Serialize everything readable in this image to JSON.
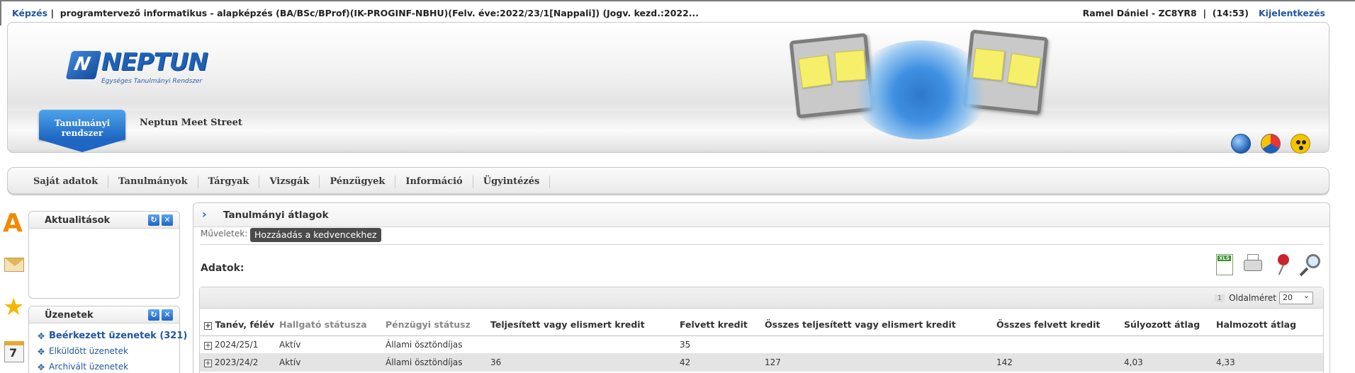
{
  "topbar": {
    "training_link": "Képzés",
    "training_text": "programtervező informatikus - alapképzés (BA/BSc/BProf)(IK-PROGINF-NBHU)(Felv. éve:2022/23/1[Nappali]) (Jogv. kezd.:2022...",
    "user": "Ramel Dániel - ZC8YR8",
    "session_time": "(14:53)",
    "logout": "Kijelentkezés"
  },
  "header": {
    "logo_text": "NEPTUN",
    "logo_sub": "Egységes Tanulmányi Rendszer",
    "tab_active": "Tanulmányi rendszer",
    "tab_other": "Neptun Meet Street"
  },
  "mainnav": {
    "items": [
      "Saját adatok",
      "Tanulmányok",
      "Tárgyak",
      "Vizsgák",
      "Pénzügyek",
      "Információ",
      "Ügyintézés"
    ]
  },
  "portlets": {
    "news": {
      "title": "Aktualitások"
    },
    "messages": {
      "title": "Üzenetek",
      "items": [
        "Beérkezett üzenetek (321)",
        "Elküldött üzenetek",
        "Archivált üzenetek"
      ]
    }
  },
  "content": {
    "title": "Tanulmányi átlagok",
    "ops_label": "Műveletek:",
    "ops_button": "Hozzáadás a kedvencekhez",
    "data_label": "Adatok:",
    "pager": {
      "page": "1",
      "label": "Oldalméret",
      "size": "20"
    },
    "columns": [
      "Tanév, félév",
      "Hallgató státusza",
      "Pénzügyi státusz",
      "Teljesített vagy elismert kredit",
      "Felvett kredit",
      "Összes teljesített vagy elismert kredit",
      "Összes felvett kredit",
      "Súlyozott átlag",
      "Halmozott átlag"
    ],
    "rows": [
      [
        "2024/25/1",
        "Aktív",
        "Állami ösztöndíjas",
        "",
        "35",
        "",
        "",
        "",
        ""
      ],
      [
        "2023/24/2",
        "Aktív",
        "Állami ösztöndíjas",
        "36",
        "42",
        "127",
        "142",
        "4,03",
        "4,33"
      ]
    ]
  }
}
